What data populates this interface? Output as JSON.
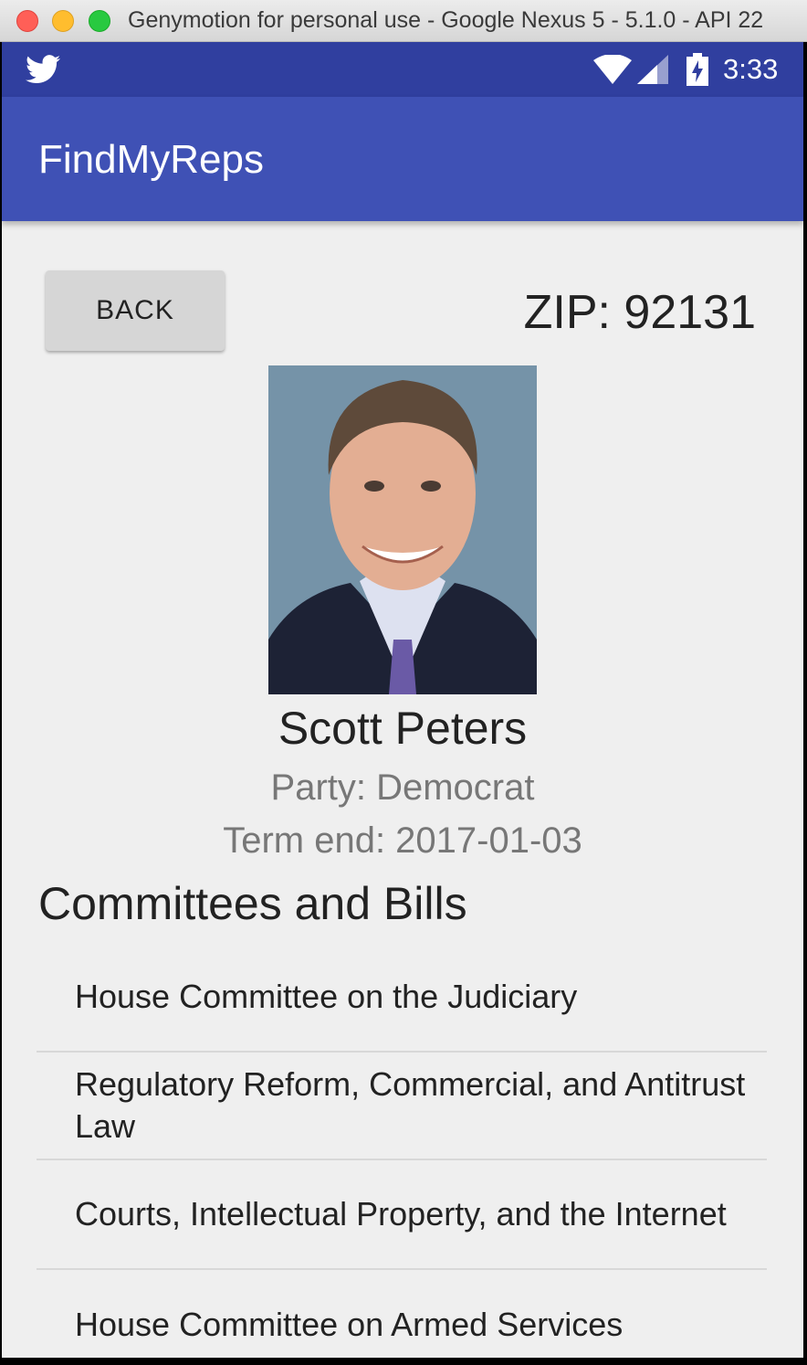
{
  "window": {
    "title": "Genymotion for personal use - Google Nexus 5 - 5.1.0 - API 22"
  },
  "status_bar": {
    "time": "3:33",
    "notification_icon": "twitter-icon",
    "icons": [
      "wifi-icon",
      "signal-icon",
      "battery-charging-icon"
    ]
  },
  "app_bar": {
    "title": "FindMyReps",
    "color": "#3f51b5",
    "status_color": "#303f9f"
  },
  "header": {
    "back_label": "BACK",
    "zip_label": "ZIP: 92131"
  },
  "rep": {
    "photo": "representative-portrait",
    "name": "Scott Peters",
    "party": "Party: Democrat",
    "term": "Term end: 2017-01-03"
  },
  "committees": {
    "title": "Committees and Bills",
    "items": [
      "House Committee on the Judiciary",
      "Regulatory Reform, Commercial, and Antitrust Law",
      "Courts, Intellectual Property, and the Internet",
      "House Committee on Armed Services"
    ]
  }
}
